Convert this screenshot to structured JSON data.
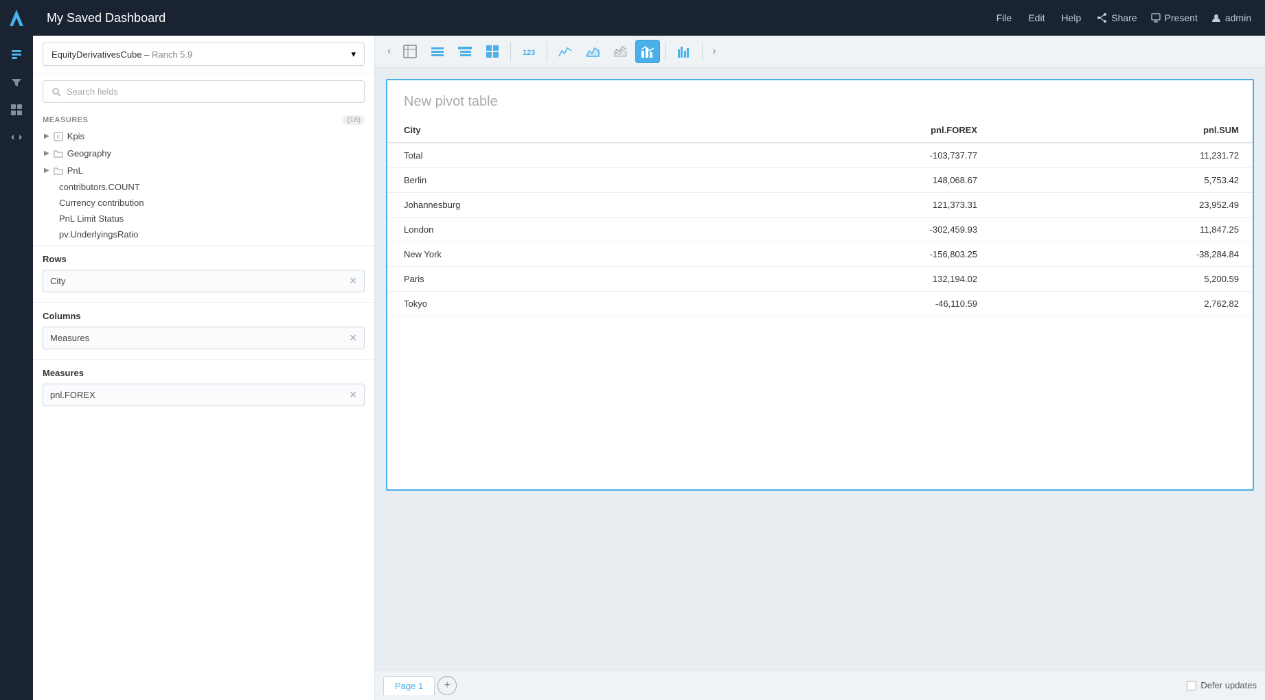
{
  "app": {
    "title": "My Saved Dashboard"
  },
  "topbar": {
    "title": "My Saved Dashboard",
    "nav": [
      "File",
      "Edit",
      "Help"
    ],
    "actions": [
      "Share",
      "Present",
      "admin"
    ]
  },
  "sidebar": {
    "cube_name": "EquityDerivativesCube",
    "cube_version": "Ranch 5.9",
    "search_placeholder": "Search fields",
    "measures_section": {
      "label": "MEASURES",
      "count": "(18)"
    },
    "groups": [
      {
        "name": "Kpis",
        "type": "kpi"
      },
      {
        "name": "Geography",
        "type": "folder"
      },
      {
        "name": "PnL",
        "type": "folder"
      }
    ],
    "fields": [
      "contributors.COUNT",
      "Currency contribution",
      "PnL Limit Status",
      "pv.UnderlyingsRatio"
    ],
    "rows_label": "Rows",
    "rows_chip": "City",
    "columns_label": "Columns",
    "columns_chip": "Measures",
    "measures_label": "Measures",
    "measures_chip": "pnl.FOREX"
  },
  "pivot": {
    "title": "New pivot table",
    "columns": [
      "City",
      "pnl.FOREX",
      "pnl.SUM"
    ],
    "rows": [
      {
        "city": "Total",
        "forex": "-103,737.77",
        "sum": "11,231.72",
        "forex_negative": true,
        "sum_negative": false,
        "is_total": true
      },
      {
        "city": "Berlin",
        "forex": "148,068.67",
        "sum": "5,753.42",
        "forex_negative": false,
        "sum_negative": false
      },
      {
        "city": "Johannesburg",
        "forex": "121,373.31",
        "sum": "23,952.49",
        "forex_negative": false,
        "sum_negative": false
      },
      {
        "city": "London",
        "forex": "-302,459.93",
        "sum": "11,847.25",
        "forex_negative": true,
        "sum_negative": false
      },
      {
        "city": "New York",
        "forex": "-156,803.25",
        "sum": "-38,284.84",
        "forex_negative": true,
        "sum_negative": true
      },
      {
        "city": "Paris",
        "forex": "132,194.02",
        "sum": "5,200.59",
        "forex_negative": false,
        "sum_negative": false
      },
      {
        "city": "Tokyo",
        "forex": "-46,110.59",
        "sum": "2,762.82",
        "forex_negative": true,
        "sum_negative": false
      }
    ]
  },
  "bottombar": {
    "page_tab": "Page 1",
    "add_page": "+",
    "defer_label": "Defer updates"
  }
}
